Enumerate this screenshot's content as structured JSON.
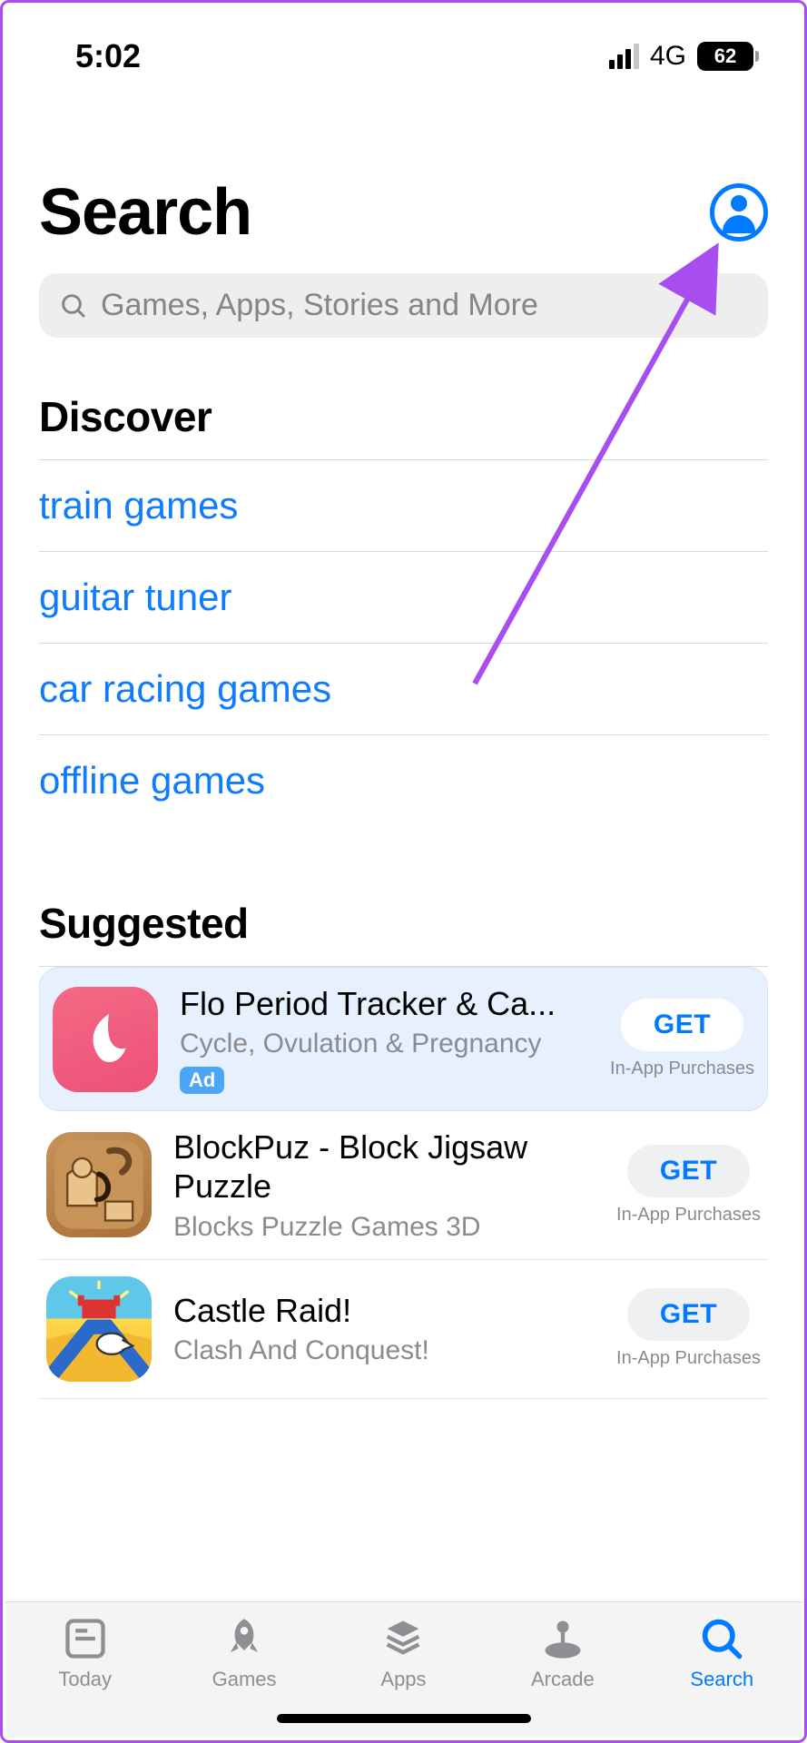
{
  "status": {
    "time": "5:02",
    "network": "4G",
    "battery": "62"
  },
  "header": {
    "title": "Search"
  },
  "search": {
    "placeholder": "Games, Apps, Stories and More"
  },
  "discover": {
    "title": "Discover",
    "items": [
      "train games",
      "guitar tuner",
      "car racing games",
      "offline games"
    ]
  },
  "suggested": {
    "title": "Suggested",
    "apps": [
      {
        "name": "Flo Period Tracker & Ca...",
        "subtitle": "Cycle, Ovulation & Pregnancy",
        "button": "GET",
        "iap": "In-App Purchases",
        "ad": "Ad",
        "sponsored": true
      },
      {
        "name": "BlockPuz - Block Jigsaw Puzzle",
        "subtitle": "Blocks Puzzle Games 3D",
        "button": "GET",
        "iap": "In-App Purchases",
        "sponsored": false
      },
      {
        "name": "Castle Raid!",
        "subtitle": "Clash And Conquest!",
        "button": "GET",
        "iap": "In-App Purchases",
        "sponsored": false
      }
    ]
  },
  "tabs": [
    {
      "label": "Today",
      "active": false
    },
    {
      "label": "Games",
      "active": false
    },
    {
      "label": "Apps",
      "active": false
    },
    {
      "label": "Arcade",
      "active": false
    },
    {
      "label": "Search",
      "active": true
    }
  ],
  "colors": {
    "link": "#0f7bff",
    "accent": "#007aff",
    "arrow": "#a84df0"
  }
}
